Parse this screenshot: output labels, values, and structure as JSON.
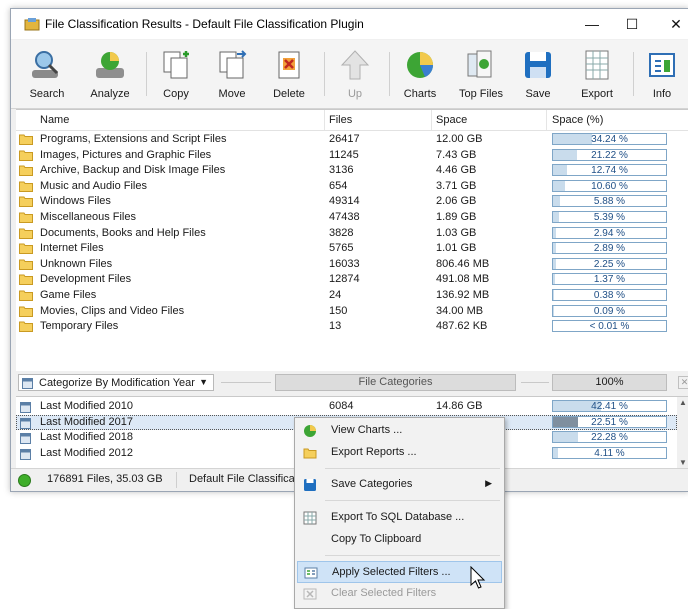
{
  "window": {
    "title": "File Classification Results - Default File Classification Plugin",
    "minimize": "—",
    "maximize": "☐",
    "close": "✕"
  },
  "toolbar": [
    {
      "label": "Search",
      "icon": "search-icon"
    },
    {
      "label": "Analyze",
      "icon": "analyze-icon"
    },
    {
      "label": "Copy",
      "icon": "copy-icon"
    },
    {
      "label": "Move",
      "icon": "move-icon"
    },
    {
      "label": "Delete",
      "icon": "delete-icon"
    },
    {
      "label": "Up",
      "icon": "up-arrow-icon",
      "disabled": true
    },
    {
      "label": "Charts",
      "icon": "charts-icon"
    },
    {
      "label": "Top Files",
      "icon": "top-files-icon"
    },
    {
      "label": "Save",
      "icon": "save-icon"
    },
    {
      "label": "Export",
      "icon": "export-icon"
    },
    {
      "label": "Info",
      "icon": "info-icon"
    }
  ],
  "columns": {
    "name": "Name",
    "files": "Files",
    "space": "Space",
    "space_pct": "Space (%)"
  },
  "categories": [
    {
      "name": "Programs, Extensions and Script Files",
      "files": "26417",
      "space": "12.00 GB",
      "pct": "34.24 %",
      "frac": 0.3424
    },
    {
      "name": "Images, Pictures and Graphic Files",
      "files": "11245",
      "space": "7.43 GB",
      "pct": "21.22 %",
      "frac": 0.2122
    },
    {
      "name": "Archive, Backup and Disk Image Files",
      "files": "3136",
      "space": "4.46 GB",
      "pct": "12.74 %",
      "frac": 0.1274
    },
    {
      "name": "Music and Audio Files",
      "files": "654",
      "space": "3.71 GB",
      "pct": "10.60 %",
      "frac": 0.106
    },
    {
      "name": "Windows Files",
      "files": "49314",
      "space": "2.06 GB",
      "pct": "5.88 %",
      "frac": 0.0588
    },
    {
      "name": "Miscellaneous Files",
      "files": "47438",
      "space": "1.89 GB",
      "pct": "5.39 %",
      "frac": 0.0539
    },
    {
      "name": "Documents, Books and Help Files",
      "files": "3828",
      "space": "1.03 GB",
      "pct": "2.94 %",
      "frac": 0.0294
    },
    {
      "name": "Internet Files",
      "files": "5765",
      "space": "1.01 GB",
      "pct": "2.89 %",
      "frac": 0.0289
    },
    {
      "name": "Unknown Files",
      "files": "16033",
      "space": "806.46 MB",
      "pct": "2.25 %",
      "frac": 0.0225
    },
    {
      "name": "Development Files",
      "files": "12874",
      "space": "491.08 MB",
      "pct": "1.37 %",
      "frac": 0.0137
    },
    {
      "name": "Game Files",
      "files": "24",
      "space": "136.92 MB",
      "pct": "0.38 %",
      "frac": 0.0038
    },
    {
      "name": "Movies, Clips and Video Files",
      "files": "150",
      "space": "34.00 MB",
      "pct": "0.09 %",
      "frac": 0.0009
    },
    {
      "name": "Temporary Files",
      "files": "13",
      "space": "487.62 KB",
      "pct": "< 0.01 %",
      "frac": 0.0
    }
  ],
  "midbar": {
    "categorize": "Categorize By Modification Year",
    "file_categories": "File Categories",
    "pct": "100%"
  },
  "years": [
    {
      "name": "Last Modified 2010",
      "files": "6084",
      "space": "14.86 GB",
      "pct": "42.41 %",
      "frac": 0.4241
    },
    {
      "name": "Last Modified 2017",
      "files": "",
      "space": "",
      "pct": "22.51 %",
      "frac": 0.2251,
      "selected": true
    },
    {
      "name": "Last Modified 2018",
      "files": "",
      "space": "",
      "pct": "22.28 %",
      "frac": 0.2228
    },
    {
      "name": "Last Modified 2012",
      "files": "",
      "space": "",
      "pct": "4.11 %",
      "frac": 0.0411
    }
  ],
  "status": {
    "summary": "176891 Files, 35.03 GB",
    "plugin": "Default File Classifica"
  },
  "context_menu": [
    {
      "label": "View Charts ...",
      "icon": "charts-icon"
    },
    {
      "label": "Export Reports ...",
      "icon": "folder-icon"
    },
    {
      "label": "Save Categories",
      "icon": "save-icon",
      "submenu": true
    },
    {
      "label": "Export To SQL Database ...",
      "icon": "database-icon"
    },
    {
      "label": "Copy To Clipboard",
      "icon": ""
    },
    {
      "label": "Apply Selected Filters ...",
      "icon": "filter-icon",
      "hover": true
    },
    {
      "label": "Clear Selected Filters",
      "icon": "clear-filter-icon",
      "disabled": true
    }
  ],
  "colors": {
    "accent": "#7fa6c7",
    "bar_fill": "#c9dcec",
    "folder": "#f5cf5c",
    "hover": "#cfe3f7"
  }
}
